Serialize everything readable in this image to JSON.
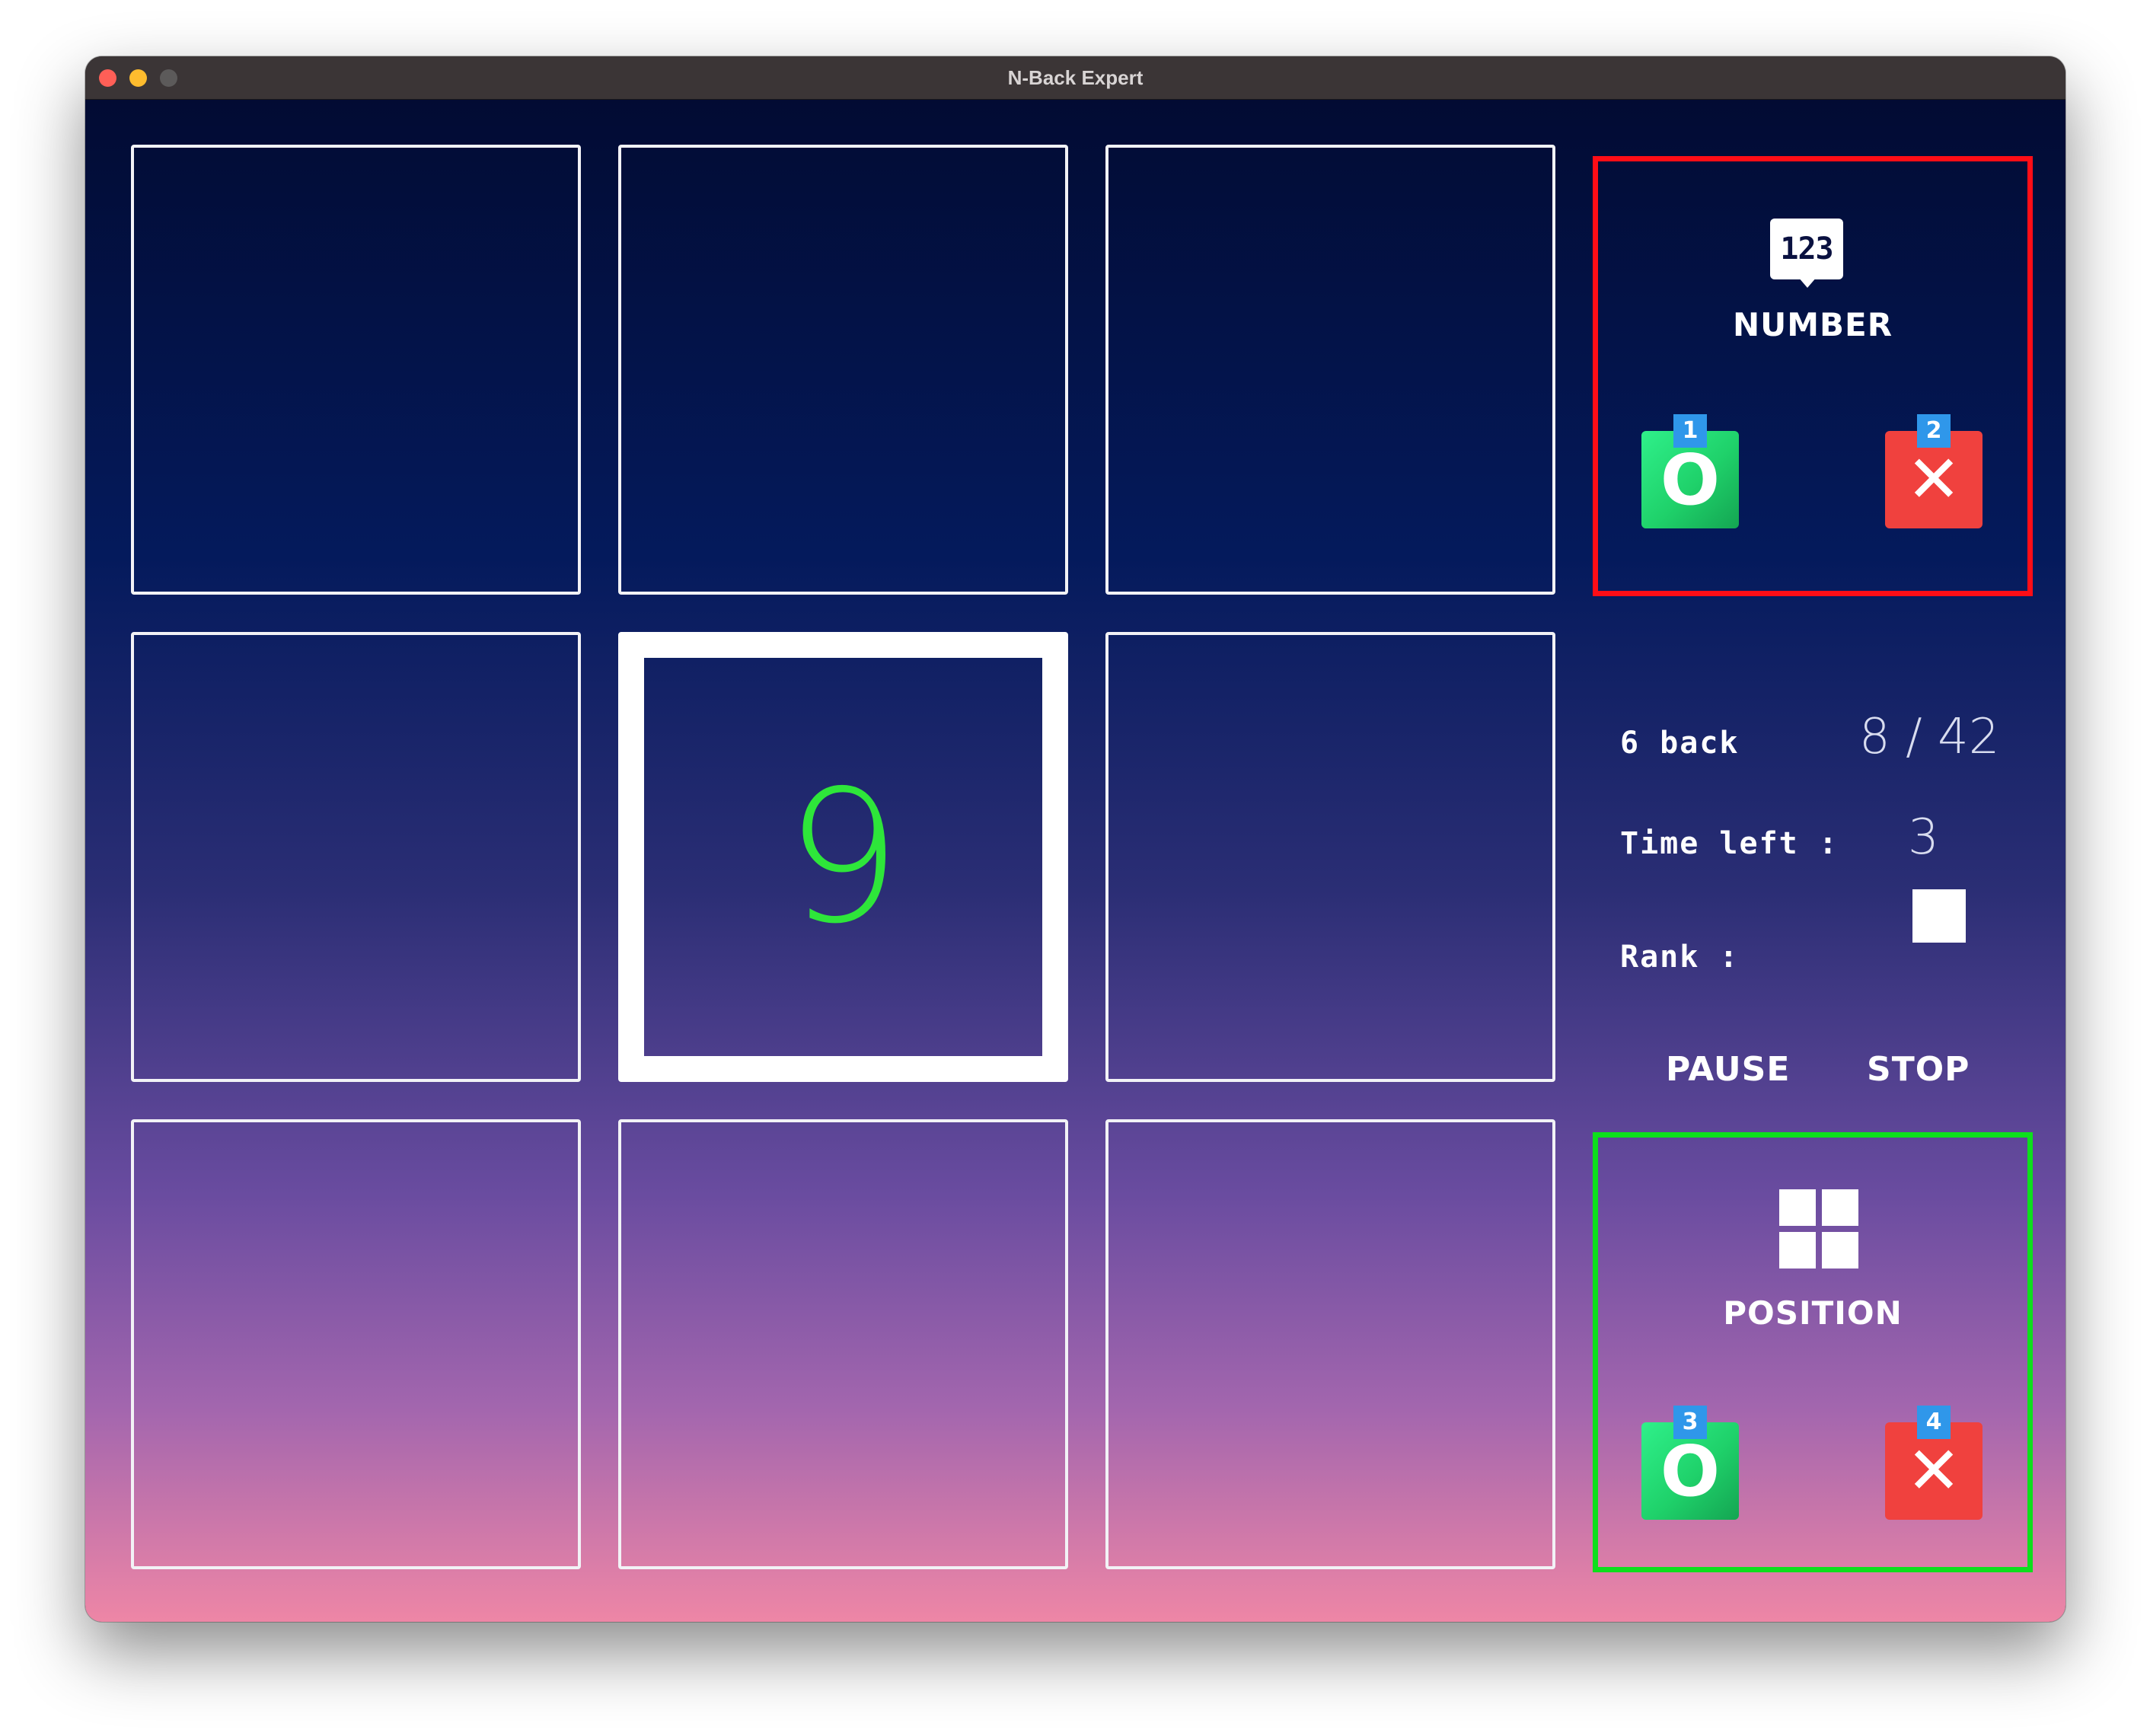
{
  "window": {
    "title": "N-Back Expert"
  },
  "grid": {
    "active_cell": 4,
    "stimulus_digit": "9",
    "stimulus_color": "#2ee63a"
  },
  "number_panel": {
    "icon": "number-123-icon",
    "icon_text": "123",
    "label": "NUMBER",
    "match": {
      "symbol": "O",
      "shortcut": "1",
      "color": "#23e07a"
    },
    "no_match": {
      "symbol": "✕",
      "shortcut": "2",
      "color": "#f0413e"
    },
    "border_color": "#ff0d16"
  },
  "status": {
    "n_back": "6 back",
    "progress": "8 / 42",
    "time_left_label": "Time left :",
    "time_left_value": "3",
    "rank_label": "Rank :"
  },
  "controls": {
    "pause": "PAUSE",
    "stop": "STOP"
  },
  "position_panel": {
    "icon": "grid-position-icon",
    "label": "POSITION",
    "match": {
      "symbol": "O",
      "shortcut": "3",
      "color": "#23e07a"
    },
    "no_match": {
      "symbol": "✕",
      "shortcut": "4",
      "color": "#f0413e"
    },
    "border_color": "#0ddf1c"
  }
}
